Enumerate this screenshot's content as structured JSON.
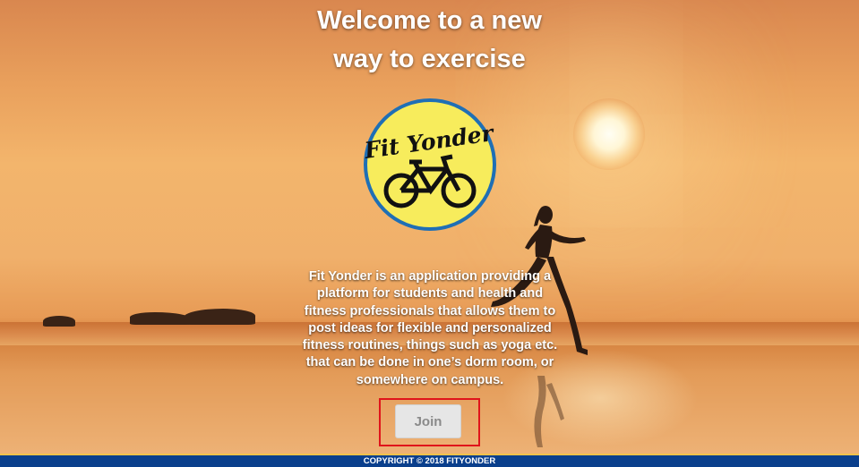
{
  "hero": {
    "headline_line1": "Welcome to a new",
    "headline_line2": "way to exercise",
    "logo_text": "Fit Yonder",
    "logo_icon": "bicycle-icon",
    "description": "Fit Yonder is an application providing a platform for students and health and fitness professionals that allows them to post ideas for flexible and personalized fitness routines, things such as yoga etc. that can be done in one’s dorm room, or somewhere on campus.",
    "join_label": "Join"
  },
  "footer": {
    "copyright": "COPYRIGHT © 2018 FITYONDER"
  },
  "colors": {
    "logo_fill": "#f7ec5c",
    "logo_ring": "#1f6fb5",
    "footer_bg": "#0a3f8c",
    "footer_stripe": "#f1c24a",
    "highlight_box": "#e0141b"
  }
}
